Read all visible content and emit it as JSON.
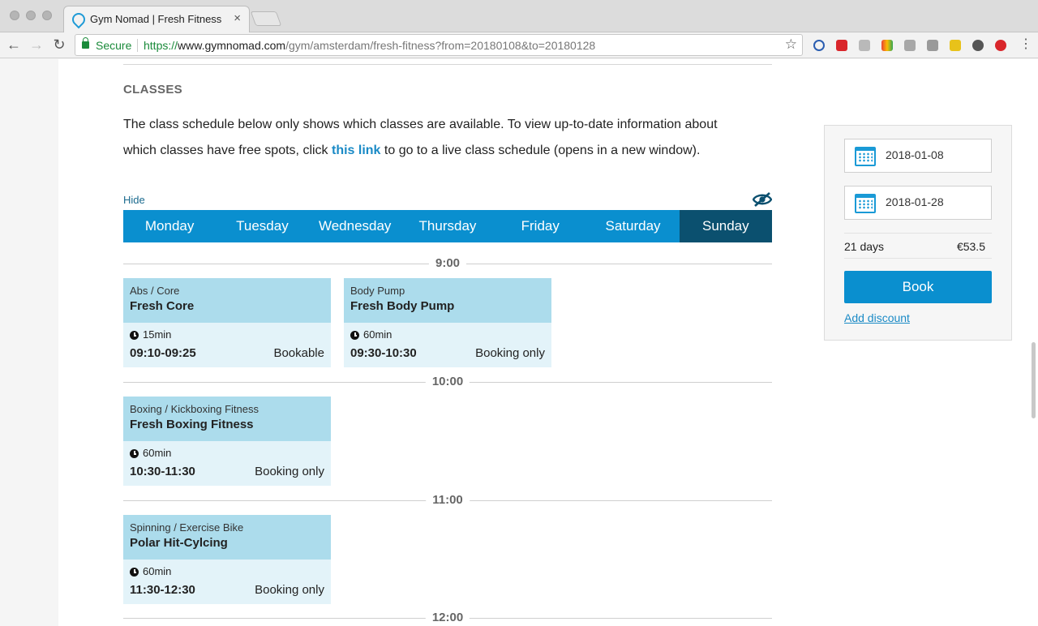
{
  "browser": {
    "tab_title": "Gym Nomad | Fresh Fitness",
    "tab_close": "×",
    "secure_label": "Secure",
    "url_scheme": "https://",
    "url_host": "www.gymnomad.com",
    "url_path": "/gym/amsterdam/fresh-fitness?from=20180108&to=20180128",
    "back_glyph": "←",
    "forward_glyph": "→",
    "reload_glyph": "↻",
    "bookmark_glyph": "☆"
  },
  "classes_section": {
    "title": "CLASSES",
    "intro_before": "The class schedule below only shows which classes are available. To view up-to-date information about which classes have free spots, click ",
    "intro_link": "this link",
    "intro_after": " to go to a live class schedule (opens in a new window).",
    "hide_label": "Hide"
  },
  "weekdays": {
    "items": [
      {
        "label": "Monday"
      },
      {
        "label": "Tuesday"
      },
      {
        "label": "Wednesday"
      },
      {
        "label": "Thursday"
      },
      {
        "label": "Friday"
      },
      {
        "label": "Saturday"
      },
      {
        "label": "Sunday"
      }
    ],
    "active": "Sunday"
  },
  "schedule": {
    "times": [
      "9:00",
      "10:00",
      "11:00",
      "12:00"
    ],
    "classes": [
      {
        "category": "Abs / Core",
        "name": "Fresh Core",
        "duration": "15min",
        "time": "09:10-09:25",
        "status": "Bookable"
      },
      {
        "category": "Body Pump",
        "name": "Fresh Body Pump",
        "duration": "60min",
        "time": "09:30-10:30",
        "status": "Booking only"
      },
      {
        "category": "Boxing / Kickboxing Fitness",
        "name": "Fresh Boxing Fitness",
        "duration": "60min",
        "time": "10:30-11:30",
        "status": "Booking only"
      },
      {
        "category": "Spinning / Exercise Bike",
        "name": "Polar Hit-Cylcing",
        "duration": "60min",
        "time": "11:30-12:30",
        "status": "Booking only"
      }
    ]
  },
  "booking": {
    "from_date": "2018-01-08",
    "to_date": "2018-01-28",
    "days": "21 days",
    "price": "€53.5",
    "book_label": "Book",
    "discount_label": "Add discount"
  },
  "colors": {
    "accent": "#0a8fcf",
    "active_day": "#0b506f",
    "card_header": "#acdcec",
    "card_body": "#e3f3f9"
  }
}
